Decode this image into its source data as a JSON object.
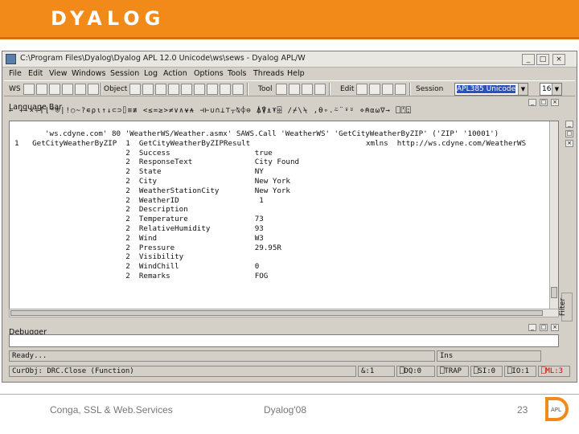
{
  "brand": "DYALOG",
  "window": {
    "title": "C:\\Program Files\\Dyalog\\Dyalog APL 12.0 Unicode\\ws\\sews - Dyalog APL/W",
    "buttons": [
      "_",
      "□",
      "×"
    ]
  },
  "menu": [
    "File",
    "Edit",
    "View",
    "Windows",
    "Session",
    "Log",
    "Action",
    "Options",
    "Tools",
    "Threads",
    "Help"
  ],
  "toolbar": {
    "ws": "WS",
    "object": "Object",
    "tool": "Tool",
    "edit": "Edit",
    "session_label": "Session",
    "session_value": "APL385 Unicode",
    "font_size": "16"
  },
  "language_bar": {
    "title": "Language Bar",
    "glyphs": "←  +-×÷⌈⌊*⍟|!○~?∊⍴⍳↑↓⊂⊃⌷≡≢  <≤=≥>≠∨∧⍱⍲  ⊣⊢∪∩⊥⊤⍪⍉⌽⊖  ⍋⍒⍎⍕⌹  /⌿\\⍀  ,⍬∘.⍨¨⍣⍤  ⋄⍝⍺⍵∇→  ⎕⍞⍠"
  },
  "session_lines": [
    {
      "indent": 38,
      "text": "'ws.cdyne.com' 80 'WeatherWS/Weather.asmx' SAWS.Call 'WeatherWS' 'GetCityWeatherByZIP' ('ZIP' '10001')"
    },
    {
      "indent": 0,
      "text": "1   GetCityWeatherByZIP  1  GetCityWeatherByZIPResult                          xmlns  http://ws.cdyne.com/WeatherWS"
    },
    {
      "indent": 0,
      "text": "                         2  Success                   true"
    },
    {
      "indent": 0,
      "text": "                         2  ResponseText              City Found"
    },
    {
      "indent": 0,
      "text": "                         2  State                     NY"
    },
    {
      "indent": 0,
      "text": "                         2  City                      New York"
    },
    {
      "indent": 0,
      "text": "                         2  WeatherStationCity        New York"
    },
    {
      "indent": 0,
      "text": "                         2  WeatherID                  1"
    },
    {
      "indent": 0,
      "text": "                         2  Description"
    },
    {
      "indent": 0,
      "text": "                         2  Temperature               73"
    },
    {
      "indent": 0,
      "text": "                         2  RelativeHumidity          93"
    },
    {
      "indent": 0,
      "text": "                         2  Wind                      W3"
    },
    {
      "indent": 0,
      "text": "                         2  Pressure                  29.95R"
    },
    {
      "indent": 0,
      "text": "                         2  Visibility"
    },
    {
      "indent": 0,
      "text": "                         2  WindChill                 0"
    },
    {
      "indent": 0,
      "text": "                         2  Remarks                   FOG"
    }
  ],
  "filter_label": "Filter",
  "debugger_label": "Debugger",
  "status": {
    "ready": "Ready...",
    "ins": "Ins",
    "curobj": "CurObj: DRC.Close (Function)",
    "io": "&:1",
    "dq": "⎕DQ:0",
    "trap": "⎕TRAP",
    "si": "⎕SI:0",
    "io2": "⎕IO:1",
    "ml": "⎕ML:3"
  },
  "footer": {
    "left": "Conga, SSL & Web.Services",
    "center": "Dyalog'08",
    "page": "23",
    "logo_text": "APL"
  },
  "colors": {
    "header_orange": "#f28a1a",
    "highlight_blue": "#2a52be",
    "ml_red": "#cc0000"
  }
}
